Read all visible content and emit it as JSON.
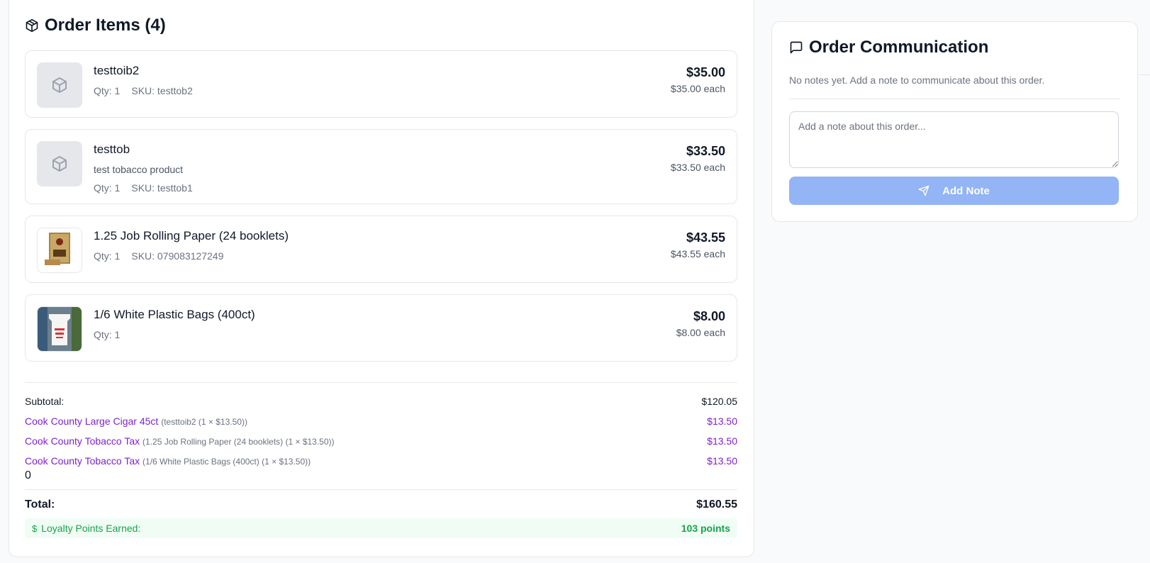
{
  "order_items": {
    "title": "Order Items (4)",
    "icon": "package-icon",
    "items": [
      {
        "name": "testtoib2",
        "desc": "",
        "qty": "Qty: 1",
        "sku": "SKU: testtob2",
        "price": "$35.00",
        "each": "$35.00 each",
        "thumb": "placeholder"
      },
      {
        "name": "testtob",
        "desc": "test tobacco product",
        "qty": "Qty: 1",
        "sku": "SKU: testtob1",
        "price": "$33.50",
        "each": "$33.50 each",
        "thumb": "placeholder"
      },
      {
        "name": "1.25 Job Rolling Paper (24 booklets)",
        "desc": "",
        "qty": "Qty: 1",
        "sku": "SKU: 079083127249",
        "price": "$43.55",
        "each": "$43.55 each",
        "thumb": "product-image"
      },
      {
        "name": "1/6 White Plastic Bags (400ct)",
        "desc": "",
        "qty": "Qty: 1",
        "sku": "",
        "price": "$8.00",
        "each": "$8.00 each",
        "thumb": "product-image"
      }
    ]
  },
  "totals": {
    "subtotal_label": "Subtotal:",
    "subtotal_value": "$120.05",
    "taxes": [
      {
        "name": "Cook County Large Cigar 45ct",
        "detail": "(testtoib2 (1 × $13.50))",
        "amount": "$13.50"
      },
      {
        "name": "Cook County Tobacco Tax",
        "detail": "(1.25 Job Rolling Paper (24 booklets) (1 × $13.50))",
        "amount": "$13.50"
      },
      {
        "name": "Cook County Tobacco Tax",
        "detail": "(1/6 White Plastic Bags (400ct) (1 × $13.50))",
        "amount": "$13.50"
      }
    ],
    "stray_value": "0",
    "total_label": "Total:",
    "total_value": "$160.55",
    "loyalty_label": "Loyalty Points Earned:",
    "loyalty_value": "103 points",
    "loyalty_icon": "dollar-icon"
  },
  "communication": {
    "title": "Order Communication",
    "icon": "message-square-icon",
    "empty_text": "No notes yet. Add a note to communicate about this order.",
    "placeholder": "Add a note about this order...",
    "button_label": "Add Note",
    "button_icon": "send-icon"
  },
  "colors": {
    "tax_purple": "#7e22ce",
    "loyalty_green": "#16a34a",
    "button_blue_disabled": "#93b4f5"
  }
}
